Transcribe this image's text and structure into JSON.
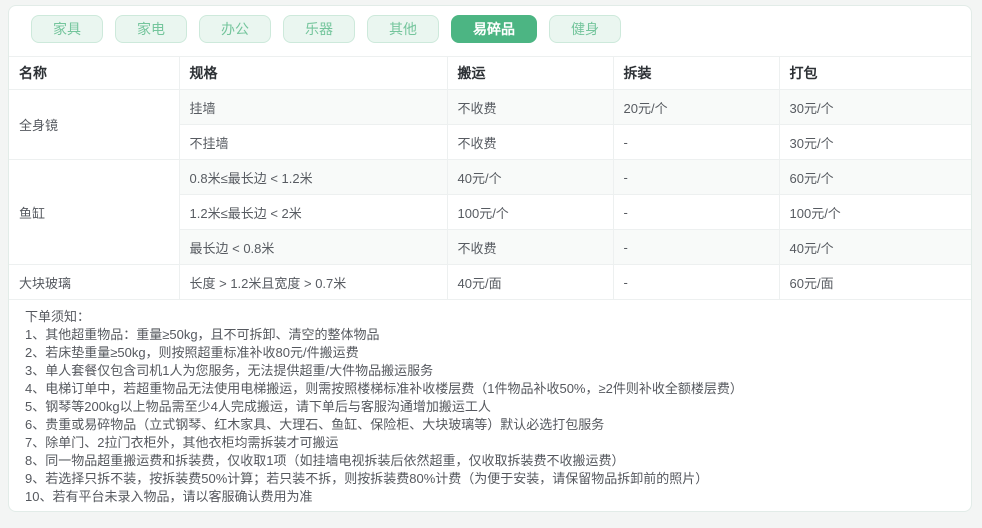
{
  "colors": {
    "accent_green": "#4cb583",
    "tab_inactive_bg": "#eaf6f0",
    "tab_inactive_border": "#cde9db",
    "tab_inactive_text": "#74c59c",
    "table_border": "#edf0f0",
    "header_text": "#2e3236",
    "cell_text": "#575b61"
  },
  "tabs": {
    "items": [
      {
        "label": "家具",
        "active": false
      },
      {
        "label": "家电",
        "active": false
      },
      {
        "label": "办公",
        "active": false
      },
      {
        "label": "乐器",
        "active": false
      },
      {
        "label": "其他",
        "active": false
      },
      {
        "label": "易碎品",
        "active": true
      },
      {
        "label": "健身",
        "active": false
      }
    ]
  },
  "table": {
    "columns": [
      "名称",
      "规格",
      "搬运",
      "拆装",
      "打包"
    ],
    "groups": [
      {
        "name": "全身镜",
        "rows": [
          {
            "spec": "挂墙",
            "carry": "不收费",
            "disassemble": "20元/个",
            "pack": "30元/个"
          },
          {
            "spec": "不挂墙",
            "carry": "不收费",
            "disassemble": "-",
            "pack": "30元/个"
          }
        ]
      },
      {
        "name": "鱼缸",
        "rows": [
          {
            "spec": "0.8米≤最长边 < 1.2米",
            "carry": "40元/个",
            "disassemble": "-",
            "pack": "60元/个"
          },
          {
            "spec": "1.2米≤最长边 < 2米",
            "carry": "100元/个",
            "disassemble": "-",
            "pack": "100元/个"
          },
          {
            "spec": "最长边 < 0.8米",
            "carry": "不收费",
            "disassemble": "-",
            "pack": "40元/个"
          }
        ]
      },
      {
        "name": "大块玻璃",
        "rows": [
          {
            "spec": "长度 > 1.2米且宽度 > 0.7米",
            "carry": "40元/面",
            "disassemble": "-",
            "pack": "60元/面"
          }
        ]
      }
    ]
  },
  "notes": {
    "title": "下单须知：",
    "items": [
      "1、其他超重物品：重量≥50kg，且不可拆卸、清空的整体物品",
      "2、若床垫重量≥50kg，则按照超重标准补收80元/件搬运费",
      "3、单人套餐仅包含司机1人为您服务，无法提供超重/大件物品搬运服务",
      "4、电梯订单中，若超重物品无法使用电梯搬运，则需按照楼梯标准补收楼层费（1件物品补收50%，≥2件则补收全额楼层费）",
      "5、钢琴等200kg以上物品需至少4人完成搬运，请下单后与客服沟通增加搬运工人",
      "6、贵重或易碎物品（立式钢琴、红木家具、大理石、鱼缸、保险柜、大块玻璃等）默认必选打包服务",
      "7、除单门、2拉门衣柜外，其他衣柜均需拆装才可搬运",
      "8、同一物品超重搬运费和拆装费，仅收取1项（如挂墙电视拆装后依然超重，仅收取拆装费不收搬运费）",
      "9、若选择只拆不装，按拆装费50%计算；若只装不拆，则按拆装费80%计费（为便于安装，请保留物品拆卸前的照片）",
      "10、若有平台未录入物品，请以客服确认费用为准"
    ]
  }
}
